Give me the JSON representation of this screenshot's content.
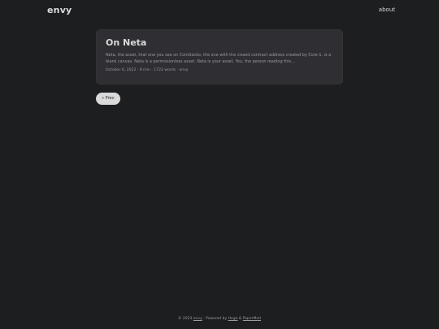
{
  "header": {
    "logo": "envy",
    "nav": [
      {
        "label": "about"
      }
    ]
  },
  "post": {
    "title": "On Neta",
    "excerpt": "Neta, the asset, that one you see on CoinGecko, the one with the closed contract address created by Core-1, is a blank canvas. Neta is a permissionless asset. Neta is your asset. You, the person reading this…",
    "date": "October 6, 2022",
    "read_time": "9 min",
    "words": "1722 words",
    "author": "envy",
    "sep": " · "
  },
  "pagination": {
    "prev_label": "« Prev"
  },
  "footer": {
    "copyright": "© 2023 ",
    "site_link": "envy",
    "powered_by": " · Powered by ",
    "hugo_link": "Hugo",
    "amp": " & ",
    "theme_link": "PaperMod"
  },
  "colors": {
    "background": "#1d1e20",
    "card": "#2e2e33",
    "primary_text": "#dadadb",
    "secondary_text": "#9b9c9d"
  }
}
